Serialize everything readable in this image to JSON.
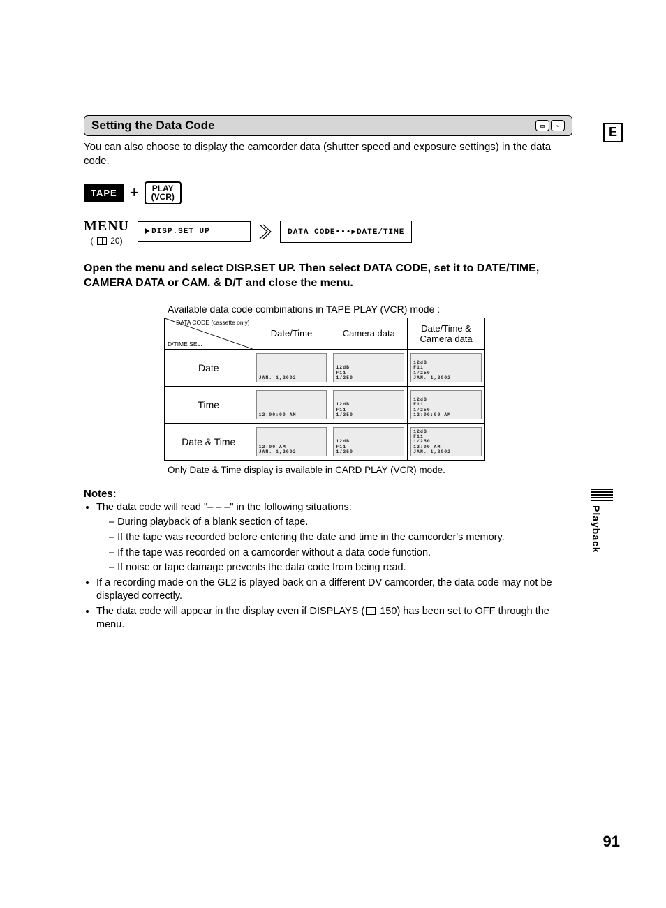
{
  "header": {
    "title": "Setting the Data Code"
  },
  "intro": "You can also choose to display the camcorder data (shutter speed and exposure settings) in the data code.",
  "mode": {
    "tape": "TAPE",
    "plus": "+",
    "play_top": "PLAY",
    "play_bottom": "(VCR)"
  },
  "menu": {
    "word": "MENU",
    "ref": "20",
    "box1": "DISP.SET UP",
    "box2": "DATA CODE•••▶DATE/TIME"
  },
  "instruction": "Open the menu and select DISP.SET UP. Then select DATA CODE, set it to DATE/TIME, CAMERA DATA or CAM. & D/T and close the menu.",
  "caption": "Available data code combinations in TAPE PLAY (VCR) mode :",
  "table": {
    "corner_top": "DATA CODE\n(cassette\nonly)",
    "corner_bottom": "D/TIME SEL.",
    "cols": [
      "Date/Time",
      "Camera data",
      "Date/Time &\nCamera data"
    ],
    "rows": [
      "Date",
      "Time",
      "Date & Time"
    ],
    "cells": [
      [
        "JAN. 1,2002",
        "12dB\nF11\n1/250",
        "12dB\nF11\n1/250\nJAN. 1,2002"
      ],
      [
        "12:00:00 AM",
        "12dB\nF11\n1/250",
        "12dB\nF11\n1/250\n12:00:00 AM"
      ],
      [
        "12:00 AM\nJAN. 1,2002",
        "12dB\nF11\n1/250",
        "12dB\nF11\n1/250\n12:00 AM\nJAN. 1,2002"
      ]
    ]
  },
  "footnote": "Only Date & Time display is available in CARD PLAY (VCR) mode.",
  "notes": {
    "heading": "Notes:",
    "b1": "The data code will read \"– – –\" in the following situations:",
    "s1": "During playback of a blank section of tape.",
    "s2": "If the tape was recorded before entering the date and time in the camcorder's memory.",
    "s3": "If the tape was recorded on a camcorder without a data code function.",
    "s4": "If noise or tape damage prevents the data code from being read.",
    "b2": "If a recording made on the GL2 is played back on a different DV camcorder, the data code may not be displayed correctly.",
    "b3a": "The data code will appear in the display even if DISPLAYS (",
    "b3ref": "150",
    "b3b": ") has been set to OFF through the menu."
  },
  "side": {
    "e": "E",
    "tab": "Playback"
  },
  "page_number": "91"
}
